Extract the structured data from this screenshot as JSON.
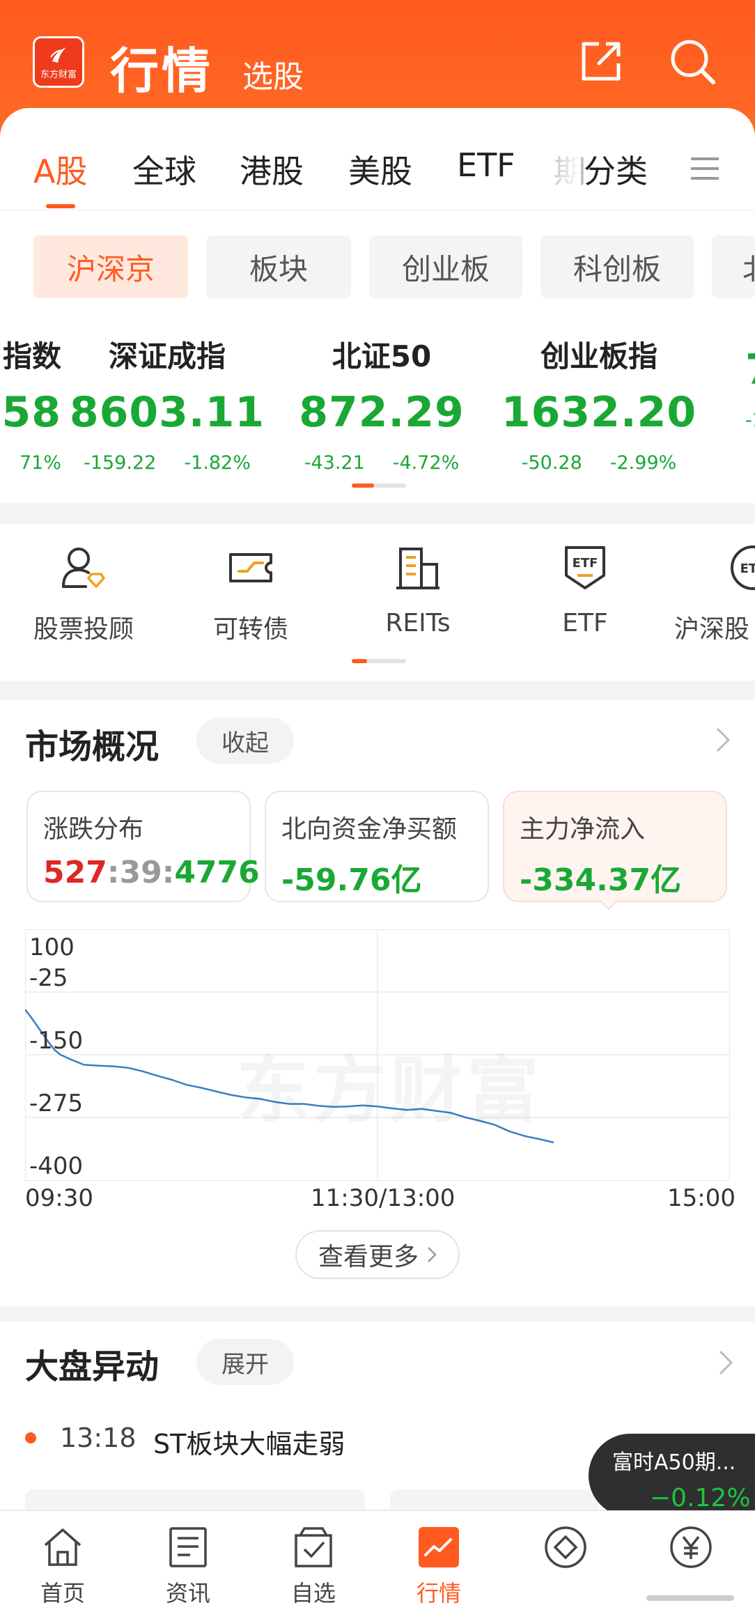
{
  "header": {
    "logo_text": "东方财富",
    "title": "行情",
    "subtitle": "选股",
    "share_icon": "share-icon",
    "search_icon": "search-icon"
  },
  "tabs": [
    {
      "label": "A股",
      "active": true
    },
    {
      "label": "全球"
    },
    {
      "label": "港股"
    },
    {
      "label": "美股"
    },
    {
      "label": "ETF"
    },
    {
      "label": "期"
    },
    {
      "label": "分类"
    }
  ],
  "subtabs": [
    {
      "label": "沪深京",
      "active": true
    },
    {
      "label": "板块"
    },
    {
      "label": "创业板"
    },
    {
      "label": "科创板"
    },
    {
      "label": "北"
    }
  ],
  "indices": [
    {
      "name": "指数",
      "value": "58",
      "change": "",
      "pct": "71%"
    },
    {
      "name": "深证成指",
      "value": "8603.11",
      "change": "-159.22",
      "pct": "-1.82%"
    },
    {
      "name": "北证50",
      "value": "872.29",
      "change": "-43.21",
      "pct": "-4.72%"
    },
    {
      "name": "创业板指",
      "value": "1632.20",
      "change": "-50.28",
      "pct": "-2.99%"
    },
    {
      "name": "",
      "value": "7",
      "change": "-1",
      "pct": ""
    }
  ],
  "quick": [
    {
      "label": "股票投顾",
      "icon": "advisor-icon"
    },
    {
      "label": "可转债",
      "icon": "convertible-bond-icon"
    },
    {
      "label": "REITs",
      "icon": "reits-building-icon"
    },
    {
      "label": "ETF",
      "icon": "etf-shield-icon"
    },
    {
      "label": "沪深股",
      "icon": "etf-circle-icon"
    }
  ],
  "market": {
    "title": "市场概况",
    "collapse_label": "收起",
    "cards": [
      {
        "label": "涨跌分布",
        "up": "527",
        "sep1": ":",
        "flat": "39",
        "sep2": ":",
        "down": "4776"
      },
      {
        "label": "北向资金净买额",
        "value": "-59.76亿"
      },
      {
        "label": "主力净流入",
        "value": "-334.37亿",
        "selected": true
      }
    ],
    "more_label": "查看更多",
    "watermark": "东方财富"
  },
  "chart_data": {
    "type": "line",
    "title": "",
    "xlabel": "",
    "ylabel": "",
    "ylim": [
      -400,
      100
    ],
    "yticks": [
      "100",
      "-25",
      "-150",
      "-275",
      "-400"
    ],
    "xticks": [
      "09:30",
      "11:30/13:00",
      "15:00"
    ],
    "grid": true,
    "series": [
      {
        "color": "#3a7fc0",
        "x": [
          0,
          2,
          5,
          8,
          10,
          12,
          15,
          20,
          25,
          30,
          35,
          40,
          45,
          50,
          55,
          60,
          65,
          70,
          75,
          80,
          85,
          90,
          95,
          100,
          105,
          110,
          115,
          120,
          125,
          130,
          135,
          140,
          145,
          150,
          155,
          160,
          165,
          170,
          175,
          180
        ],
        "values": [
          -60,
          -75,
          -100,
          -125,
          -140,
          -150,
          -158,
          -170,
          -172,
          -173,
          -176,
          -183,
          -192,
          -200,
          -210,
          -216,
          -223,
          -230,
          -235,
          -238,
          -244,
          -248,
          -248,
          -252,
          -254,
          -253,
          -251,
          -253,
          -257,
          -260,
          -258,
          -262,
          -266,
          -275,
          -282,
          -290,
          -303,
          -312,
          -318,
          -325
        ]
      }
    ]
  },
  "movement": {
    "title": "大盘异动",
    "expand_label": "展开",
    "items": [
      {
        "time": "13:18",
        "text": "ST板块大幅走弱"
      }
    ]
  },
  "float_quote": {
    "name": "富时A50期...",
    "value": "−0.12%"
  },
  "nav": [
    {
      "label": "首页",
      "icon": "home-icon"
    },
    {
      "label": "资讯",
      "icon": "news-icon"
    },
    {
      "label": "自选",
      "icon": "watchlist-icon"
    },
    {
      "label": "行情",
      "icon": "market-icon",
      "active": true
    },
    {
      "label": "",
      "icon": "diamond-icon"
    },
    {
      "label": "",
      "icon": "yuan-icon"
    }
  ]
}
